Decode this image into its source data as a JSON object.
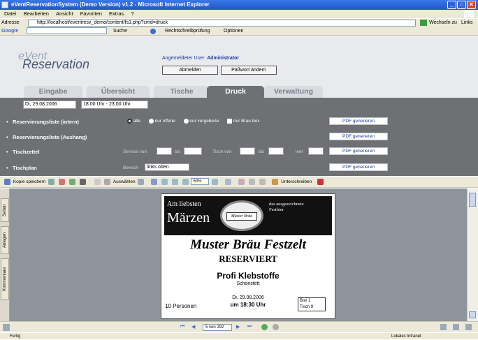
{
  "window": {
    "title": "eVentReservationSystem (Demo Version) v1.2 - Microsoft Internet Explorer",
    "minimize": "_",
    "maximize": "□",
    "close": "✕"
  },
  "menu": [
    "Datei",
    "Bearbeiten",
    "Ansicht",
    "Favoriten",
    "Extras",
    "?"
  ],
  "address": {
    "label": "Adresse",
    "url": "http://localhost/eventresv_demo/content/fs1.php?cmd=druck",
    "go": "Wechseln zu",
    "links": "Links"
  },
  "google": {
    "brand": "Google",
    "search": "Suche",
    "spell": "Rechtschreibprüfung",
    "options": "Optionen"
  },
  "app": {
    "logo_e": "eVent",
    "logo": "Reservation",
    "user_label": "Angemeldeter User:",
    "user_name": "Administrator",
    "logout": "Abmelden",
    "change_pw": "Paßwort ändern",
    "tabs": [
      "Eingabe",
      "Übersicht",
      "Tische",
      "Druck",
      "Verwaltung"
    ],
    "date": "Di, 29.08.2006",
    "time": "18:00 Uhr - 23:00 Uhr"
  },
  "rows": {
    "r1": {
      "label": "Reservierungsliste (intern)",
      "opts": [
        "alle",
        "nur offene",
        "nur vergebene",
        "nur Brau-box"
      ]
    },
    "r2": {
      "label": "Reservierungsliste (Aushang)"
    },
    "r3": {
      "label": "Tischzettel",
      "service": "Service von",
      "bis1": "bis",
      "tisch": "Tisch von",
      "bis2": "bis",
      "leer": "leer"
    },
    "r4": {
      "label": "Tischplan",
      "bereich": "Bereich",
      "bereich_val": "links oben"
    },
    "pdf": "PDF generieren"
  },
  "pdf_toolbar": {
    "save": "Kopie speichern",
    "select": "Auswählen",
    "zoom": "50%",
    "sign": "Unterschreiben"
  },
  "side_tabs": [
    "Seiten",
    "Anlagen",
    "Kommentare"
  ],
  "doc": {
    "banner_left1": "Am liebsten",
    "banner_left2": "Märzen",
    "seal": "Muster Bräu",
    "banner_right": "das ausgezeichnete Festbier",
    "festzelt": "Muster Bräu Festzelt",
    "reserviert": "RESERVIERT",
    "company": "Profi Klebstoffe",
    "city": "Schonstett",
    "date": "Di, 29.08.2006",
    "time": "um 18:30 Uhr",
    "persons": "10 Personen",
    "box": "Box 1",
    "table": "Tisch 9"
  },
  "nav": {
    "page": "5 von 292"
  },
  "status": {
    "left": "Fertig",
    "right": "Lokales Intranet"
  },
  "colors": {
    "app_gray": "#6e7074",
    "active_tab": "#6e7074",
    "banner": "#111111"
  }
}
